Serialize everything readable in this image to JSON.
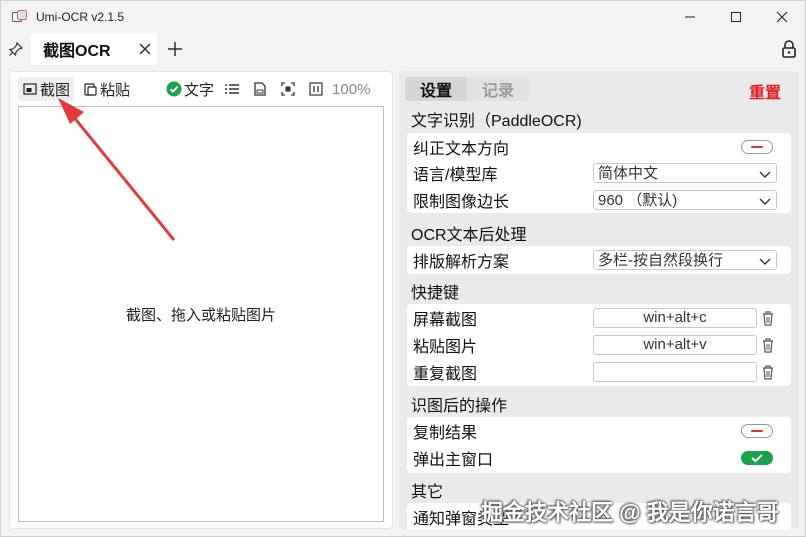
{
  "window": {
    "title": "Umi-OCR v2.1.5"
  },
  "tabbar": {
    "active_tab": "截图OCR"
  },
  "toolbar": {
    "screenshot_label": "截图",
    "paste_label": "粘贴",
    "text_label": "文字",
    "zoom": "100%"
  },
  "canvas": {
    "hint": "截图、拖入或粘贴图片"
  },
  "settings": {
    "tab_settings": "设置",
    "tab_records": "记录",
    "reset": "重置",
    "ocr_section": "文字识别（PaddleOCR)",
    "correct_direction": "纠正文本方向",
    "language_label": "语言/模型库",
    "language_value": "简体中文",
    "limit_label": "限制图像边长",
    "limit_value": "960 （默认)",
    "post_section": "OCR文本后处理",
    "layout_label": "排版解析方案",
    "layout_value": "多栏-按自然段换行",
    "hotkey_section": "快捷键",
    "hk_screenshot_label": "屏幕截图",
    "hk_screenshot_value": "win+alt+c",
    "hk_paste_label": "粘贴图片",
    "hk_paste_value": "win+alt+v",
    "hk_repeat_label": "重复截图",
    "hk_repeat_value": "",
    "after_section": "识图后的操作",
    "copy_result": "复制结果",
    "popup_main": "弹出主窗口",
    "other_section": "其它",
    "notify_popup": "通知弹窗类型"
  },
  "watermark": "掘金技术社区 @ 我是你诺言哥",
  "colors": {
    "accent_red": "#e02020",
    "toggle_green": "#1aa34a"
  }
}
